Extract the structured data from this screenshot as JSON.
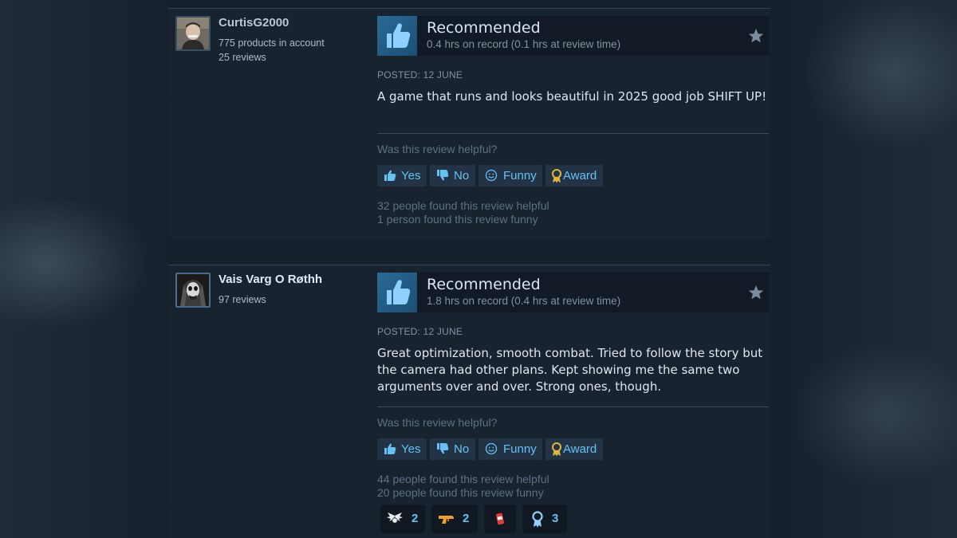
{
  "reviews": [
    {
      "author": "CurtisG2000",
      "meta": [
        "775 products in account",
        "25 reviews"
      ],
      "recommendation": "Recommended",
      "hours": "0.4 hrs on record (0.1 hrs at review time)",
      "posted": "POSTED: 12 JUNE",
      "text": "A game that runs and looks beautiful in 2025 good job SHIFT UP!",
      "helpful_question": "Was this review helpful?",
      "buttons": {
        "yes": "Yes",
        "no": "No",
        "funny": "Funny",
        "award": "Award"
      },
      "stats": [
        "32 people found this review helpful",
        "1 person found this review funny"
      ]
    },
    {
      "author": "Vais Varg O Røthh",
      "meta": [
        "97 reviews"
      ],
      "recommendation": "Recommended",
      "hours": "1.8 hrs on record (0.4 hrs at review time)",
      "posted": "POSTED: 12 JUNE",
      "text": "Great optimization, smooth combat. Tried to follow the story but the camera had other plans. Kept showing me the same two arguments over and over. Strong ones, though.",
      "helpful_question": "Was this review helpful?",
      "buttons": {
        "yes": "Yes",
        "no": "No",
        "funny": "Funny",
        "award": "Award"
      },
      "stats": [
        "44 people found this review helpful",
        "20 people found this review funny"
      ],
      "awards": [
        {
          "icon": "winged-award-icon",
          "count": "2"
        },
        {
          "icon": "gun-award-icon",
          "count": "2"
        },
        {
          "icon": "soda-can-award-icon",
          "count": ""
        },
        {
          "icon": "ribbon-medal-award-icon",
          "count": "3"
        }
      ]
    }
  ],
  "colors": {
    "background": "#1b2838",
    "link_blue": "#67c1f5",
    "thumb_blue": "#2b6a97",
    "award_gold": "#e2b53a"
  }
}
